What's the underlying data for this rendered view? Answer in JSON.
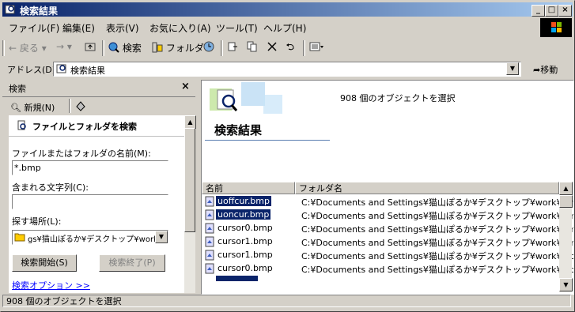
{
  "window": {
    "title": "検索結果"
  },
  "menu": [
    "ファイル(F)",
    "編集(E)",
    "表示(V)",
    "お気に入り(A)",
    "ツール(T)",
    "ヘルプ(H)"
  ],
  "toolbar": {
    "back": "戻る",
    "search": "検索",
    "folders": "フォルダ"
  },
  "address": {
    "label": "アドレス(D)",
    "value": "検索結果",
    "go": "移動"
  },
  "search_pane": {
    "title": "検索",
    "new_label": "新規(N)",
    "heading": "ファイルとフォルダを検索",
    "name_label": "ファイルまたはフォルダの名前(M):",
    "name_value": "*.bmp",
    "text_label": "含まれる文字列(C):",
    "text_value": "",
    "location_label": "探す場所(L):",
    "location_value": "gs¥猫山ぽるか¥デスクトップ¥work",
    "start_button": "検索開始(S)",
    "stop_button": "検索終了(P)",
    "options_link": "検索オプション >>"
  },
  "results": {
    "banner_title": "検索結果",
    "count_text": "908 個のオブジェクトを選択",
    "columns": [
      "名前",
      "フォルダ名"
    ],
    "rows": [
      {
        "name": "uoffcur.bmp",
        "folder": "C:¥Documents and Settings¥猫山ぽるか¥デスクトップ¥work¥bmp¥e",
        "selected": true
      },
      {
        "name": "uoncur.bmp",
        "folder": "C:¥Documents and Settings¥猫山ぽるか¥デスクトップ¥work¥bmp¥e",
        "selected": true
      },
      {
        "name": "cursor0.bmp",
        "folder": "C:¥Documents and Settings¥猫山ぽるか¥デスクトップ¥work¥bmp¥e",
        "selected": false
      },
      {
        "name": "cursor1.bmp",
        "folder": "C:¥Documents and Settings¥猫山ぽるか¥デスクトップ¥work¥bmp¥e",
        "selected": false
      },
      {
        "name": "cursor1.bmp",
        "folder": "C:¥Documents and Settings¥猫山ぽるか¥デスクトップ¥work¥sfb_bn",
        "selected": false
      },
      {
        "name": "cursor0.bmp",
        "folder": "C:¥Documents and Settings¥猫山ぽるか¥デスクトップ¥work¥sfb_bn",
        "selected": false
      }
    ]
  },
  "status": {
    "text": "908 個のオブジェクトを選択"
  }
}
